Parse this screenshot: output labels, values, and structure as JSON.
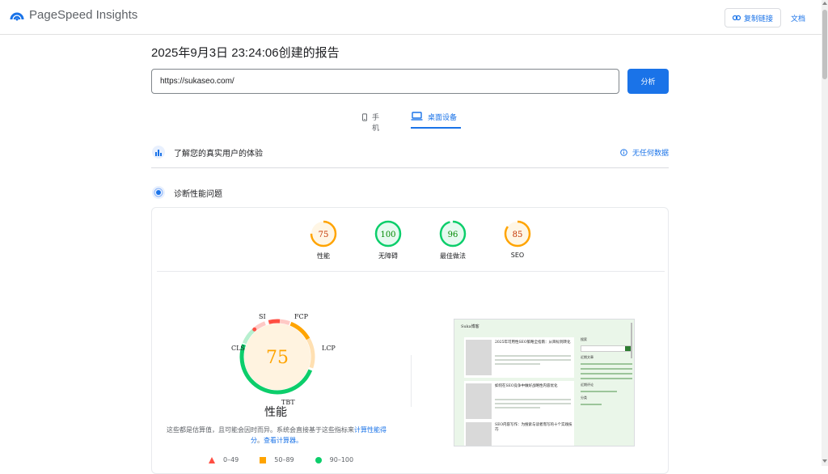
{
  "header": {
    "brand": "PageSpeed Insights",
    "copy_link": "复制链接",
    "docs": "文档"
  },
  "report": {
    "title": "2025年9月3日 23:24:06创建的报告",
    "url": "https://sukaseo.com/",
    "analyze": "分析"
  },
  "tabs": [
    {
      "label": "手机",
      "icon": "phone-icon"
    },
    {
      "label": "桌面设备",
      "icon": "laptop-icon"
    }
  ],
  "crux": {
    "title": "了解您的真实用户的体验",
    "no_data": "无任何数据"
  },
  "diagnose": {
    "title": "诊断性能问题"
  },
  "scores": [
    {
      "value": "75",
      "label": "性能",
      "color": "#ffa400"
    },
    {
      "value": "100",
      "label": "无障碍",
      "color": "#0cce6b"
    },
    {
      "value": "96",
      "label": "最佳做法",
      "color": "#0cce6b"
    },
    {
      "value": "85",
      "label": "SEO",
      "color": "#ffa400"
    }
  ],
  "performance": {
    "score": "75",
    "label": "性能",
    "metrics": [
      "SI",
      "FCP",
      "LCP",
      "TBT",
      "CLS"
    ],
    "desc_main": "这些都是估算值，且可能会因时而异。系统会直接基于这些指标来",
    "desc_link1": "计算性能得分",
    "desc_mid": "。",
    "desc_link2": "查看计算器。"
  },
  "legend": [
    {
      "range": "0–49",
      "color": "#ff4e42"
    },
    {
      "range": "50–89",
      "color": "#ffa400"
    },
    {
      "range": "90–100",
      "color": "#0cce6b"
    }
  ],
  "screenshot": {
    "site_name": "Suka博客",
    "posts": [
      "2025年可用性SEO策略全指南：从目标到转化",
      "如何在SEO竞争中做好战略性内容优化",
      "SEO内容写作：为搜索与读者而写的十个实践技巧"
    ],
    "sidebar": [
      "搜索",
      "近期文章",
      "近期评论",
      "分类"
    ]
  }
}
